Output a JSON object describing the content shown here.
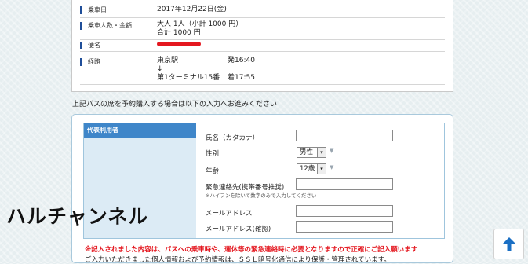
{
  "summary": {
    "date_label": "乗車日",
    "date_value": "2017年12月22日(金)",
    "passengers_label": "乗車人数・金額",
    "passengers_line1": "大人 1人（小計 1000 円）",
    "passengers_line2": "合計 1000 円",
    "service_label": "便名",
    "route_label": "経路",
    "route_from": "東京駅",
    "route_arrow": "↓",
    "route_to": "第1ターミナル15番",
    "depart_time": "発16:40",
    "arrive_time": "着17:55"
  },
  "notice": "上記バスの席を予約購入する場合は以下の入力へお進みください",
  "form": {
    "section_title": "代表利用者",
    "name_label": "氏名（カタカナ）",
    "gender_label": "性別",
    "gender_value": "男性",
    "age_label": "年齢",
    "age_value": "12歳",
    "phone_label": "緊急連絡先(携帯番号推奨)",
    "phone_hint": "※ハイフンを除いて数字のみで入力してください",
    "email_label": "メールアドレス",
    "email_confirm_label": "メールアドレス(確認)"
  },
  "warning": "※記入されました内容は、バスへの乗車時や、運休等の緊急連絡時に必要となりますので正確にご記入願います",
  "privacy": "ご入力いただきました個人情報および予約情報は、ＳＳＬ暗号化通信により保護・管理されています。",
  "watermark": "ハルチャンネル",
  "colors": {
    "accent_blue": "#3f86c9",
    "warning_red": "#e4171f",
    "scroll_arrow": "#1a6fc4"
  }
}
